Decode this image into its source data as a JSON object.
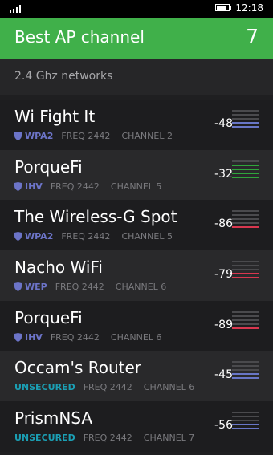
{
  "status": {
    "time": "12:18"
  },
  "header": {
    "title": "Best AP channel",
    "best_channel": "7",
    "accent": "#40b04a"
  },
  "section": {
    "title": "2.4 Ghz networks"
  },
  "networks": [
    {
      "ssid": "Wi Fight It",
      "security": "WPA2",
      "freq": "FREQ 2442",
      "channel": "CHANNEL 2",
      "rssi": "-48",
      "level": 2,
      "color": "blue"
    },
    {
      "ssid": "PorqueFi",
      "security": "IHV",
      "freq": "FREQ 2442",
      "channel": "CHANNEL 5",
      "rssi": "-32",
      "level": 4,
      "color": "green"
    },
    {
      "ssid": "The Wireless-G Spot",
      "security": "WPA2",
      "freq": "FREQ 2442",
      "channel": "CHANNEL 5",
      "rssi": "-86",
      "level": 1,
      "color": "red"
    },
    {
      "ssid": "Nacho WiFi",
      "security": "WEP",
      "freq": "FREQ 2442",
      "channel": "CHANNEL 6",
      "rssi": "-79",
      "level": 2,
      "color": "red"
    },
    {
      "ssid": "PorqueFi",
      "security": "IHV",
      "freq": "FREQ 2442",
      "channel": "CHANNEL 6",
      "rssi": "-89",
      "level": 1,
      "color": "red"
    },
    {
      "ssid": "Occam's Router",
      "security": "UNSECURED",
      "freq": "FREQ 2442",
      "channel": "CHANNEL 6",
      "rssi": "-45",
      "level": 2,
      "color": "blue"
    },
    {
      "ssid": "PrismNSA",
      "security": "UNSECURED",
      "freq": "FREQ 2442",
      "channel": "CHANNEL 7",
      "rssi": "-56",
      "level": 2,
      "color": "blue"
    }
  ]
}
